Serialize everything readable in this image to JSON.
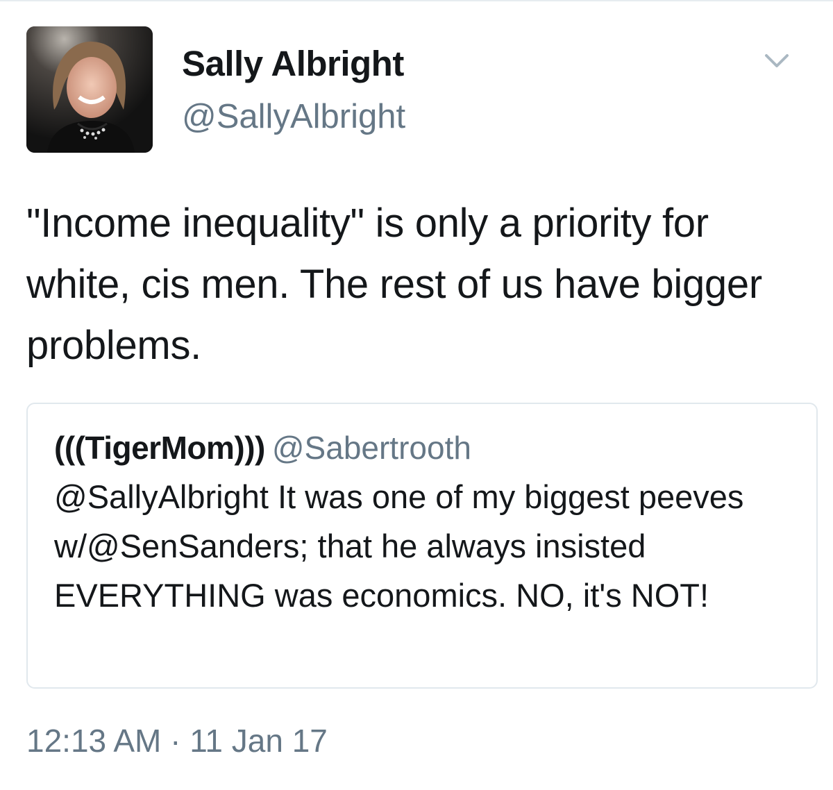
{
  "tweet": {
    "author": {
      "display_name": "Sally Albright",
      "handle": "@SallyAlbright",
      "avatar_icon": "profile-photo"
    },
    "text": "\"Income inequality\" is only a priority for white, cis men. The rest of us have bigger problems.",
    "menu_icon": "chevron-down-icon",
    "quoted": {
      "display_name": "(((TigerMom)))",
      "handle": "@Sabertrooth",
      "text": "@SallyAlbright It was one of my biggest peeves w/@SenSanders; that he always insisted EVERYTHING was economics. NO, it's NOT!"
    },
    "timestamp": "12:13 AM · 11 Jan 17"
  },
  "colors": {
    "primary_text": "#14171a",
    "secondary_text": "#657786",
    "border": "#e1e8ed"
  }
}
